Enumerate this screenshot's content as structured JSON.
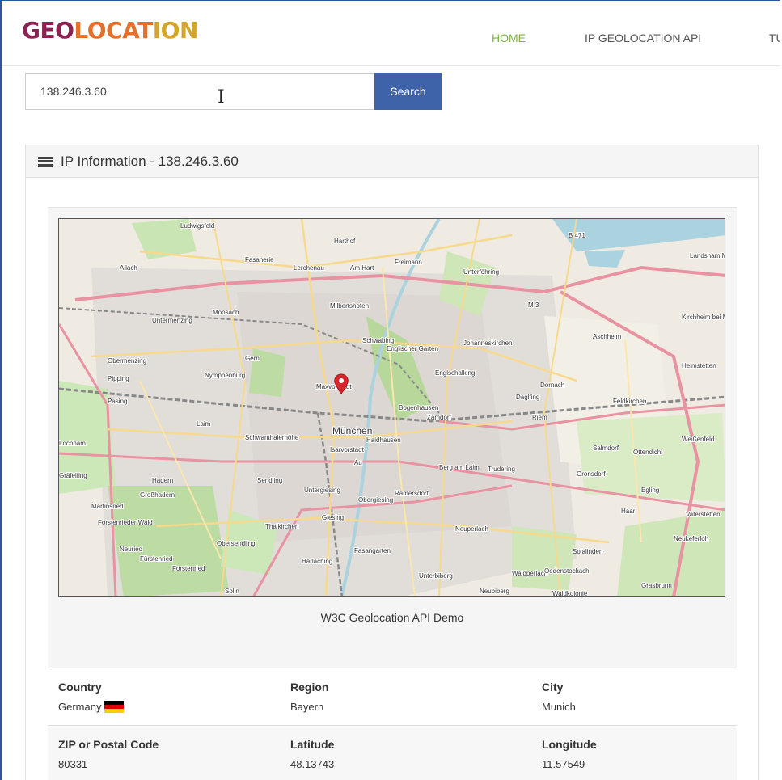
{
  "brand": {
    "part1": "GEO",
    "part2": "LOCAT",
    "part3": "ION"
  },
  "nav": [
    {
      "label": "HOME",
      "active": true
    },
    {
      "label": "IP GEOLOCATION API",
      "active": false
    },
    {
      "label": "TU",
      "active": false
    }
  ],
  "search": {
    "value": "138.246.3.60",
    "button": "Search"
  },
  "panel": {
    "title": "IP Information - 138.246.3.60",
    "map_caption": "W3C Geolocation API Demo"
  },
  "map": {
    "labels": [
      "Ludwigsfeld",
      "Harthof",
      "Fasanerie",
      "Lerchenau",
      "Am Hart",
      "Freimann",
      "Unterföhring",
      "Allach",
      "Milbertshofen",
      "Moosach",
      "Untermenzing",
      "Schwabing",
      "Johanneskirchen",
      "Aschheim",
      "Kirchheim bei München",
      "Obermenzing",
      "Gern",
      "Englischer Garten",
      "Englschalking",
      "Heimstetten",
      "Pipping",
      "Nymphenburg",
      "Maxvorstadt",
      "Dornach",
      "Daglfing",
      "Pasing",
      "Bogenhausen",
      "Feldkirchen",
      "Laim",
      "München",
      "Zamdorf",
      "Riem",
      "Lochham",
      "Schwanthalerhöhe",
      "Haidhausen",
      "Isarvorstadt",
      "Salmdorf",
      "Ottendichl",
      "Weißenfeld",
      "Au",
      "Berg am Laim",
      "Trudering",
      "Gronsdorf",
      "Gräfelfing",
      "Hadern",
      "Sendling",
      "Großhadern",
      "Untergiesing",
      "Ramersdorf",
      "Obergiesing",
      "Egling",
      "Martinsried",
      "Haar",
      "Vaterstetten",
      "Forstenrieder Wald",
      "Thalkirchen",
      "Giesing",
      "Neuperlach",
      "Obersendling",
      "Neukeferloh",
      "Neuried",
      "Fasangarten",
      "Solalinden",
      "Fürstenried",
      "Forstenried",
      "Harlaching",
      "Waldperlach",
      "Oedenstockach",
      "Unterbiberg",
      "Grasbrunn",
      "Solln",
      "Neubiberg",
      "Waldkolonie",
      "B 471",
      "M 3",
      "Landsham Moos"
    ]
  },
  "info": [
    [
      {
        "label": "Country",
        "value": "Germany",
        "flag": true
      },
      {
        "label": "Region",
        "value": "Bayern"
      },
      {
        "label": "City",
        "value": "Munich"
      }
    ],
    [
      {
        "label": "ZIP or Postal Code",
        "value": "80331"
      },
      {
        "label": "Latitude",
        "value": "48.13743"
      },
      {
        "label": "Longitude",
        "value": "11.57549"
      }
    ]
  ],
  "colors": {
    "accent_nav": "#7cb342",
    "button": "#3f63a8",
    "marker": "#d9262f",
    "flag_black": "#000000",
    "flag_red": "#dd0000",
    "flag_gold": "#ffce00"
  }
}
